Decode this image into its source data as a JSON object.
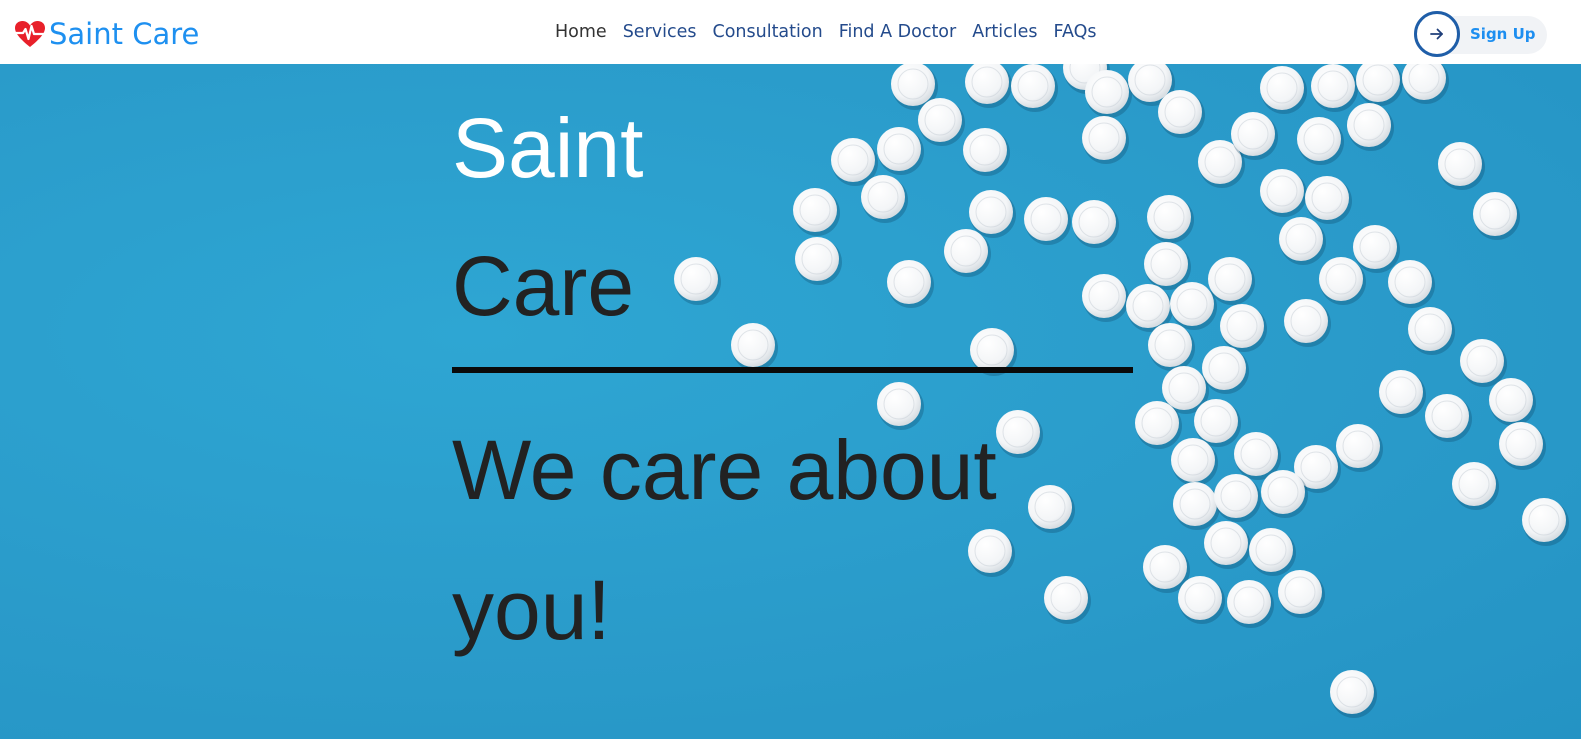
{
  "brand": {
    "name": "Saint Care",
    "icon": "heart-pulse-icon",
    "color": "#1e90f0",
    "icon_color": "#e8202a"
  },
  "nav": {
    "items": [
      {
        "label": "Home",
        "active": true
      },
      {
        "label": "Services"
      },
      {
        "label": "Consultation"
      },
      {
        "label": "Find A Doctor"
      },
      {
        "label": "Articles"
      },
      {
        "label": "FAQs"
      }
    ],
    "link_color": "#244b8c",
    "active_color": "#333333"
  },
  "signup": {
    "label": "Sign Up",
    "icon": "arrow-right-icon",
    "color": "#1d8ef0"
  },
  "hero": {
    "title_line1": "Saint",
    "title_line2": "Care",
    "tagline": "We care about you!",
    "background_color": "#2a9bca",
    "background_image": "white pills scattered on blue surface"
  }
}
